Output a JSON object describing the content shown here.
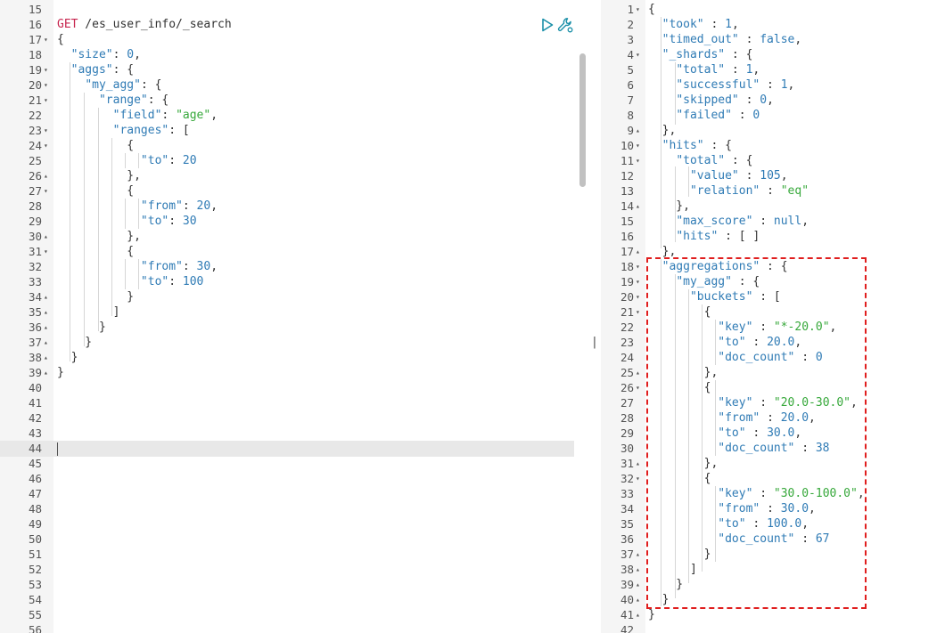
{
  "request": {
    "method": "GET",
    "path": " /es_user_info/_search",
    "lines": [
      {
        "n": "15",
        "fold": "",
        "text": ""
      },
      {
        "n": "16",
        "fold": "",
        "text": "__REQ__"
      },
      {
        "n": "17",
        "fold": "▾",
        "text": "{"
      },
      {
        "n": "18",
        "fold": "",
        "text": "  \"size\": 0,"
      },
      {
        "n": "19",
        "fold": "▾",
        "text": "  \"aggs\": {"
      },
      {
        "n": "20",
        "fold": "▾",
        "text": "    \"my_agg\": {"
      },
      {
        "n": "21",
        "fold": "▾",
        "text": "      \"range\": {"
      },
      {
        "n": "22",
        "fold": "",
        "text": "        \"field\": \"age\","
      },
      {
        "n": "23",
        "fold": "▾",
        "text": "        \"ranges\": ["
      },
      {
        "n": "24",
        "fold": "▾",
        "text": "          {"
      },
      {
        "n": "25",
        "fold": "",
        "text": "            \"to\": 20"
      },
      {
        "n": "26",
        "fold": "▴",
        "text": "          },"
      },
      {
        "n": "27",
        "fold": "▾",
        "text": "          {"
      },
      {
        "n": "28",
        "fold": "",
        "text": "            \"from\": 20,"
      },
      {
        "n": "29",
        "fold": "",
        "text": "            \"to\": 30"
      },
      {
        "n": "30",
        "fold": "▴",
        "text": "          },"
      },
      {
        "n": "31",
        "fold": "▾",
        "text": "          {"
      },
      {
        "n": "32",
        "fold": "",
        "text": "            \"from\": 30,"
      },
      {
        "n": "33",
        "fold": "",
        "text": "            \"to\": 100"
      },
      {
        "n": "34",
        "fold": "▴",
        "text": "          }"
      },
      {
        "n": "35",
        "fold": "▴",
        "text": "        ]"
      },
      {
        "n": "36",
        "fold": "▴",
        "text": "      }"
      },
      {
        "n": "37",
        "fold": "▴",
        "text": "    }"
      },
      {
        "n": "38",
        "fold": "▴",
        "text": "  }"
      },
      {
        "n": "39",
        "fold": "▴",
        "text": "}"
      },
      {
        "n": "40",
        "fold": "",
        "text": ""
      },
      {
        "n": "41",
        "fold": "",
        "text": ""
      },
      {
        "n": "42",
        "fold": "",
        "text": ""
      },
      {
        "n": "43",
        "fold": "",
        "text": ""
      },
      {
        "n": "44",
        "fold": "",
        "text": ""
      },
      {
        "n": "45",
        "fold": "",
        "text": ""
      },
      {
        "n": "46",
        "fold": "",
        "text": ""
      },
      {
        "n": "47",
        "fold": "",
        "text": ""
      },
      {
        "n": "48",
        "fold": "",
        "text": ""
      },
      {
        "n": "49",
        "fold": "",
        "text": ""
      },
      {
        "n": "50",
        "fold": "",
        "text": ""
      },
      {
        "n": "51",
        "fold": "",
        "text": ""
      },
      {
        "n": "52",
        "fold": "",
        "text": ""
      },
      {
        "n": "53",
        "fold": "",
        "text": ""
      },
      {
        "n": "54",
        "fold": "",
        "text": ""
      },
      {
        "n": "55",
        "fold": "",
        "text": ""
      },
      {
        "n": "56",
        "fold": "",
        "text": ""
      }
    ]
  },
  "response": {
    "lines": [
      {
        "n": "1",
        "fold": "▾",
        "text": "{"
      },
      {
        "n": "2",
        "fold": "",
        "text": "  \"took\" : 1,"
      },
      {
        "n": "3",
        "fold": "",
        "text": "  \"timed_out\" : false,"
      },
      {
        "n": "4",
        "fold": "▾",
        "text": "  \"_shards\" : {"
      },
      {
        "n": "5",
        "fold": "",
        "text": "    \"total\" : 1,"
      },
      {
        "n": "6",
        "fold": "",
        "text": "    \"successful\" : 1,"
      },
      {
        "n": "7",
        "fold": "",
        "text": "    \"skipped\" : 0,"
      },
      {
        "n": "8",
        "fold": "",
        "text": "    \"failed\" : 0"
      },
      {
        "n": "9",
        "fold": "▴",
        "text": "  },"
      },
      {
        "n": "10",
        "fold": "▾",
        "text": "  \"hits\" : {"
      },
      {
        "n": "11",
        "fold": "▾",
        "text": "    \"total\" : {"
      },
      {
        "n": "12",
        "fold": "",
        "text": "      \"value\" : 105,"
      },
      {
        "n": "13",
        "fold": "",
        "text": "      \"relation\" : \"eq\""
      },
      {
        "n": "14",
        "fold": "▴",
        "text": "    },"
      },
      {
        "n": "15",
        "fold": "",
        "text": "    \"max_score\" : null,"
      },
      {
        "n": "16",
        "fold": "",
        "text": "    \"hits\" : [ ]"
      },
      {
        "n": "17",
        "fold": "▴",
        "text": "  },"
      },
      {
        "n": "18",
        "fold": "▾",
        "text": "  \"aggregations\" : {"
      },
      {
        "n": "19",
        "fold": "▾",
        "text": "    \"my_agg\" : {"
      },
      {
        "n": "20",
        "fold": "▾",
        "text": "      \"buckets\" : ["
      },
      {
        "n": "21",
        "fold": "▾",
        "text": "        {"
      },
      {
        "n": "22",
        "fold": "",
        "text": "          \"key\" : \"*-20.0\","
      },
      {
        "n": "23",
        "fold": "",
        "text": "          \"to\" : 20.0,"
      },
      {
        "n": "24",
        "fold": "",
        "text": "          \"doc_count\" : 0"
      },
      {
        "n": "25",
        "fold": "▴",
        "text": "        },"
      },
      {
        "n": "26",
        "fold": "▾",
        "text": "        {"
      },
      {
        "n": "27",
        "fold": "",
        "text": "          \"key\" : \"20.0-30.0\","
      },
      {
        "n": "28",
        "fold": "",
        "text": "          \"from\" : 20.0,"
      },
      {
        "n": "29",
        "fold": "",
        "text": "          \"to\" : 30.0,"
      },
      {
        "n": "30",
        "fold": "",
        "text": "          \"doc_count\" : 38"
      },
      {
        "n": "31",
        "fold": "▴",
        "text": "        },"
      },
      {
        "n": "32",
        "fold": "▾",
        "text": "        {"
      },
      {
        "n": "33",
        "fold": "",
        "text": "          \"key\" : \"30.0-100.0\","
      },
      {
        "n": "34",
        "fold": "",
        "text": "          \"from\" : 30.0,"
      },
      {
        "n": "35",
        "fold": "",
        "text": "          \"to\" : 100.0,"
      },
      {
        "n": "36",
        "fold": "",
        "text": "          \"doc_count\" : 67"
      },
      {
        "n": "37",
        "fold": "▴",
        "text": "        }"
      },
      {
        "n": "38",
        "fold": "▴",
        "text": "      ]"
      },
      {
        "n": "39",
        "fold": "▴",
        "text": "    }"
      },
      {
        "n": "40",
        "fold": "▴",
        "text": "  }"
      },
      {
        "n": "41",
        "fold": "▴",
        "text": "}"
      },
      {
        "n": "42",
        "fold": "",
        "text": ""
      }
    ]
  },
  "icons": {
    "run": "play-icon",
    "settings": "wrench-icon"
  },
  "resize_handle": "||",
  "colors": {
    "key": "#2f7bb5",
    "string": "#36a83a",
    "method": "#c7254e",
    "highlight": "#e01e1e"
  }
}
